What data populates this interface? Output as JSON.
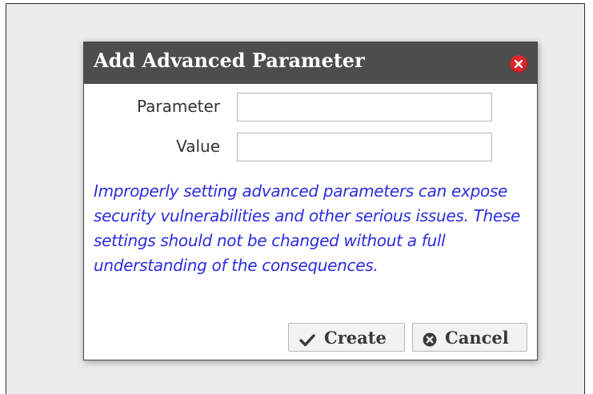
{
  "dialog": {
    "title": "Add Advanced Parameter",
    "close_icon": "close-icon",
    "fields": [
      {
        "label": "Parameter",
        "value": "",
        "placeholder": ""
      },
      {
        "label": "Value",
        "value": "",
        "placeholder": ""
      }
    ],
    "warning": "Improperly setting advanced parameters can expose security vulnerabilities and other serious issues. These settings should not be changed without a full understanding of the consequences.",
    "buttons": {
      "create_label": "Create",
      "create_icon": "checkmark-icon",
      "cancel_label": "Cancel",
      "cancel_icon": "cancel-circle-icon"
    }
  },
  "colors": {
    "titlebar": "#4d4d4d",
    "close": "#e0262c",
    "warning_text": "#2d2dde",
    "background": "#ececec"
  }
}
